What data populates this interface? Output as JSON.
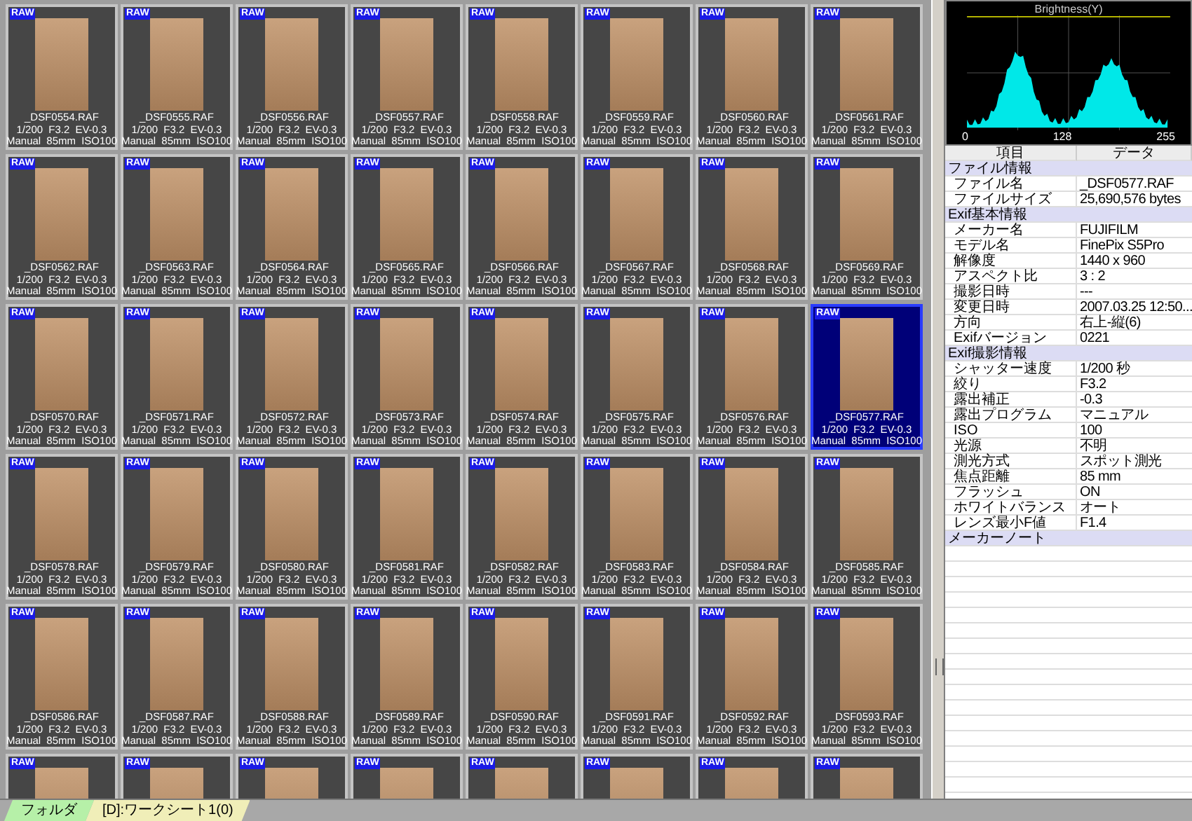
{
  "thumbnails": [
    {
      "badge": "RAW",
      "filename": "_DSF0554.RAF",
      "exposure": "1/200  F3.2  EV-0.3",
      "lens": "Manual  85mm  ISO100",
      "selected": false
    },
    {
      "badge": "RAW",
      "filename": "_DSF0555.RAF",
      "exposure": "1/200  F3.2  EV-0.3",
      "lens": "Manual  85mm  ISO100",
      "selected": false
    },
    {
      "badge": "RAW",
      "filename": "_DSF0556.RAF",
      "exposure": "1/200  F3.2  EV-0.3",
      "lens": "Manual  85mm  ISO100",
      "selected": false
    },
    {
      "badge": "RAW",
      "filename": "_DSF0557.RAF",
      "exposure": "1/200  F3.2  EV-0.3",
      "lens": "Manual  85mm  ISO100",
      "selected": false
    },
    {
      "badge": "RAW",
      "filename": "_DSF0558.RAF",
      "exposure": "1/200  F3.2  EV-0.3",
      "lens": "Manual  85mm  ISO100",
      "selected": false
    },
    {
      "badge": "RAW",
      "filename": "_DSF0559.RAF",
      "exposure": "1/200  F3.2  EV-0.3",
      "lens": "Manual  85mm  ISO100",
      "selected": false
    },
    {
      "badge": "RAW",
      "filename": "_DSF0560.RAF",
      "exposure": "1/200  F3.2  EV-0.3",
      "lens": "Manual  85mm  ISO100",
      "selected": false
    },
    {
      "badge": "RAW",
      "filename": "_DSF0561.RAF",
      "exposure": "1/200  F3.2  EV-0.3",
      "lens": "Manual  85mm  ISO100",
      "selected": false
    },
    {
      "badge": "RAW",
      "filename": "_DSF0562.RAF",
      "exposure": "1/200  F3.2  EV-0.3",
      "lens": "Manual  85mm  ISO100",
      "selected": false
    },
    {
      "badge": "RAW",
      "filename": "_DSF0563.RAF",
      "exposure": "1/200  F3.2  EV-0.3",
      "lens": "Manual  85mm  ISO100",
      "selected": false
    },
    {
      "badge": "RAW",
      "filename": "_DSF0564.RAF",
      "exposure": "1/200  F3.2  EV-0.3",
      "lens": "Manual  85mm  ISO100",
      "selected": false
    },
    {
      "badge": "RAW",
      "filename": "_DSF0565.RAF",
      "exposure": "1/200  F3.2  EV-0.3",
      "lens": "Manual  85mm  ISO100",
      "selected": false
    },
    {
      "badge": "RAW",
      "filename": "_DSF0566.RAF",
      "exposure": "1/200  F3.2  EV-0.3",
      "lens": "Manual  85mm  ISO100",
      "selected": false
    },
    {
      "badge": "RAW",
      "filename": "_DSF0567.RAF",
      "exposure": "1/200  F3.2  EV-0.3",
      "lens": "Manual  85mm  ISO100",
      "selected": false
    },
    {
      "badge": "RAW",
      "filename": "_DSF0568.RAF",
      "exposure": "1/200  F3.2  EV-0.3",
      "lens": "Manual  85mm  ISO100",
      "selected": false
    },
    {
      "badge": "RAW",
      "filename": "_DSF0569.RAF",
      "exposure": "1/200  F3.2  EV-0.3",
      "lens": "Manual  85mm  ISO100",
      "selected": false
    },
    {
      "badge": "RAW",
      "filename": "_DSF0570.RAF",
      "exposure": "1/200  F3.2  EV-0.3",
      "lens": "Manual  85mm  ISO100",
      "selected": false
    },
    {
      "badge": "RAW",
      "filename": "_DSF0571.RAF",
      "exposure": "1/200  F3.2  EV-0.3",
      "lens": "Manual  85mm  ISO100",
      "selected": false
    },
    {
      "badge": "RAW",
      "filename": "_DSF0572.RAF",
      "exposure": "1/200  F3.2  EV-0.3",
      "lens": "Manual  85mm  ISO100",
      "selected": false
    },
    {
      "badge": "RAW",
      "filename": "_DSF0573.RAF",
      "exposure": "1/200  F3.2  EV-0.3",
      "lens": "Manual  85mm  ISO100",
      "selected": false
    },
    {
      "badge": "RAW",
      "filename": "_DSF0574.RAF",
      "exposure": "1/200  F3.2  EV-0.3",
      "lens": "Manual  85mm  ISO100",
      "selected": false
    },
    {
      "badge": "RAW",
      "filename": "_DSF0575.RAF",
      "exposure": "1/200  F3.2  EV-0.3",
      "lens": "Manual  85mm  ISO100",
      "selected": false
    },
    {
      "badge": "RAW",
      "filename": "_DSF0576.RAF",
      "exposure": "1/200  F3.2  EV-0.3",
      "lens": "Manual  85mm  ISO100",
      "selected": false
    },
    {
      "badge": "RAW",
      "filename": "_DSF0577.RAF",
      "exposure": "1/200  F3.2  EV-0.3",
      "lens": "Manual  85mm  ISO100",
      "selected": true
    },
    {
      "badge": "RAW",
      "filename": "_DSF0578.RAF",
      "exposure": "1/200  F3.2  EV-0.3",
      "lens": "Manual  85mm  ISO100",
      "selected": false
    },
    {
      "badge": "RAW",
      "filename": "_DSF0579.RAF",
      "exposure": "1/200  F3.2  EV-0.3",
      "lens": "Manual  85mm  ISO100",
      "selected": false
    },
    {
      "badge": "RAW",
      "filename": "_DSF0580.RAF",
      "exposure": "1/200  F3.2  EV-0.3",
      "lens": "Manual  85mm  ISO100",
      "selected": false
    },
    {
      "badge": "RAW",
      "filename": "_DSF0581.RAF",
      "exposure": "1/200  F3.2  EV-0.3",
      "lens": "Manual  85mm  ISO100",
      "selected": false
    },
    {
      "badge": "RAW",
      "filename": "_DSF0582.RAF",
      "exposure": "1/200  F3.2  EV-0.3",
      "lens": "Manual  85mm  ISO100",
      "selected": false
    },
    {
      "badge": "RAW",
      "filename": "_DSF0583.RAF",
      "exposure": "1/200  F3.2  EV-0.3",
      "lens": "Manual  85mm  ISO100",
      "selected": false
    },
    {
      "badge": "RAW",
      "filename": "_DSF0584.RAF",
      "exposure": "1/200  F3.2  EV-0.3",
      "lens": "Manual  85mm  ISO100",
      "selected": false
    },
    {
      "badge": "RAW",
      "filename": "_DSF0585.RAF",
      "exposure": "1/200  F3.2  EV-0.3",
      "lens": "Manual  85mm  ISO100",
      "selected": false
    },
    {
      "badge": "RAW",
      "filename": "_DSF0586.RAF",
      "exposure": "1/200  F3.2  EV-0.3",
      "lens": "Manual  85mm  ISO100",
      "selected": false
    },
    {
      "badge": "RAW",
      "filename": "_DSF0587.RAF",
      "exposure": "1/200  F3.2  EV-0.3",
      "lens": "Manual  85mm  ISO100",
      "selected": false
    },
    {
      "badge": "RAW",
      "filename": "_DSF0588.RAF",
      "exposure": "1/200  F3.2  EV-0.3",
      "lens": "Manual  85mm  ISO100",
      "selected": false
    },
    {
      "badge": "RAW",
      "filename": "_DSF0589.RAF",
      "exposure": "1/200  F3.2  EV-0.3",
      "lens": "Manual  85mm  ISO100",
      "selected": false
    },
    {
      "badge": "RAW",
      "filename": "_DSF0590.RAF",
      "exposure": "1/200  F3.2  EV-0.3",
      "lens": "Manual  85mm  ISO100",
      "selected": false
    },
    {
      "badge": "RAW",
      "filename": "_DSF0591.RAF",
      "exposure": "1/200  F3.2  EV-0.3",
      "lens": "Manual  85mm  ISO100",
      "selected": false
    },
    {
      "badge": "RAW",
      "filename": "_DSF0592.RAF",
      "exposure": "1/200  F3.2  EV-0.3",
      "lens": "Manual  85mm  ISO100",
      "selected": false
    },
    {
      "badge": "RAW",
      "filename": "_DSF0593.RAF",
      "exposure": "1/200  F3.2  EV-0.3",
      "lens": "Manual  85mm  ISO100",
      "selected": false
    },
    {
      "badge": "RAW",
      "selected": false
    },
    {
      "badge": "RAW",
      "selected": false
    },
    {
      "badge": "RAW",
      "selected": false
    },
    {
      "badge": "RAW",
      "selected": false
    },
    {
      "badge": "RAW",
      "selected": false
    },
    {
      "badge": "RAW",
      "selected": false
    },
    {
      "badge": "RAW",
      "selected": false
    },
    {
      "badge": "RAW",
      "selected": false
    }
  ],
  "histogram": {
    "title": "Brightness(Y)",
    "axis_labels": [
      "0",
      "128",
      "255"
    ]
  },
  "properties": {
    "columns": [
      "項目",
      "データ"
    ],
    "sections": [
      {
        "title": "ファイル情報",
        "rows": [
          {
            "label": "ファイル名",
            "value": "_DSF0577.RAF"
          },
          {
            "label": "ファイルサイズ",
            "value": "25,690,576 bytes"
          }
        ]
      },
      {
        "title": "Exif基本情報",
        "rows": [
          {
            "label": "メーカー名",
            "value": "FUJIFILM"
          },
          {
            "label": "モデル名",
            "value": "FinePix S5Pro"
          },
          {
            "label": "解像度",
            "value": "1440 x 960"
          },
          {
            "label": "アスペクト比",
            "value": "3 : 2"
          },
          {
            "label": "撮影日時",
            "value": "---"
          },
          {
            "label": "変更日時",
            "value": "2007.03.25 12:50..."
          },
          {
            "label": "方向",
            "value": "右上-縦(6)"
          },
          {
            "label": "Exifバージョン",
            "value": "0221"
          }
        ]
      },
      {
        "title": "Exif撮影情報",
        "rows": [
          {
            "label": "シャッター速度",
            "value": "1/200 秒"
          },
          {
            "label": "絞り",
            "value": "F3.2"
          },
          {
            "label": "露出補正",
            "value": "-0.3"
          },
          {
            "label": "露出プログラム",
            "value": "マニュアル"
          },
          {
            "label": "ISO",
            "value": "100"
          },
          {
            "label": "光源",
            "value": "不明"
          },
          {
            "label": "測光方式",
            "value": "スポット測光"
          },
          {
            "label": "焦点距離",
            "value": "85 mm"
          },
          {
            "label": "フラッシュ",
            "value": "ON"
          },
          {
            "label": "ホワイトバランス",
            "value": "オート"
          },
          {
            "label": "レンズ最小F値",
            "value": "F1.4"
          }
        ]
      },
      {
        "title": "メーカーノート"
      }
    ]
  },
  "tabs": [
    {
      "label": "フォルダ",
      "selected": true
    },
    {
      "label": "[D]:ワークシート1(0)",
      "selected": false
    }
  ]
}
